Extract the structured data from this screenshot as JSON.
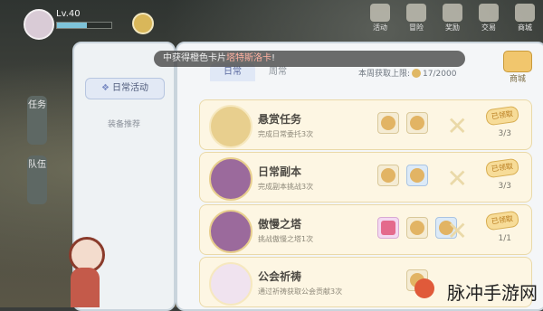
{
  "hud": {
    "level": "Lv.40",
    "icons": [
      {
        "name": "icon-1",
        "label": "活动"
      },
      {
        "name": "icon-2",
        "label": "冒险"
      },
      {
        "name": "icon-3",
        "label": "奖励"
      },
      {
        "name": "icon-4",
        "label": "交易"
      },
      {
        "name": "icon-5",
        "label": "商城"
      }
    ],
    "side_buttons": [
      "任务",
      "队伍"
    ]
  },
  "notice": {
    "prefix": "中获得橙色卡片",
    "highlight": "塔特斯洛卡",
    "suffix": "!"
  },
  "left_panel": {
    "active": "日常活动",
    "item": "装备推荐"
  },
  "main": {
    "tabs": [
      "日常",
      "周常"
    ],
    "weekly_label": "本周获取上限:",
    "weekly_value": "17/2000",
    "shop_label": "商城"
  },
  "tasks": [
    {
      "name": "悬赏任务",
      "desc": "完成日常委托3次",
      "progress": "3/3",
      "status": "已领取"
    },
    {
      "name": "日常副本",
      "desc": "完成副本挑战3次",
      "progress": "3/3",
      "status": "已领取"
    },
    {
      "name": "傲慢之塔",
      "desc": "挑战傲慢之塔1次",
      "progress": "1/1",
      "status": "已领取"
    },
    {
      "name": "公会祈祷",
      "desc": "通过祈祷获取公会贡献3次",
      "progress": "",
      "status": ""
    }
  ],
  "watermark": "脉冲手游网"
}
